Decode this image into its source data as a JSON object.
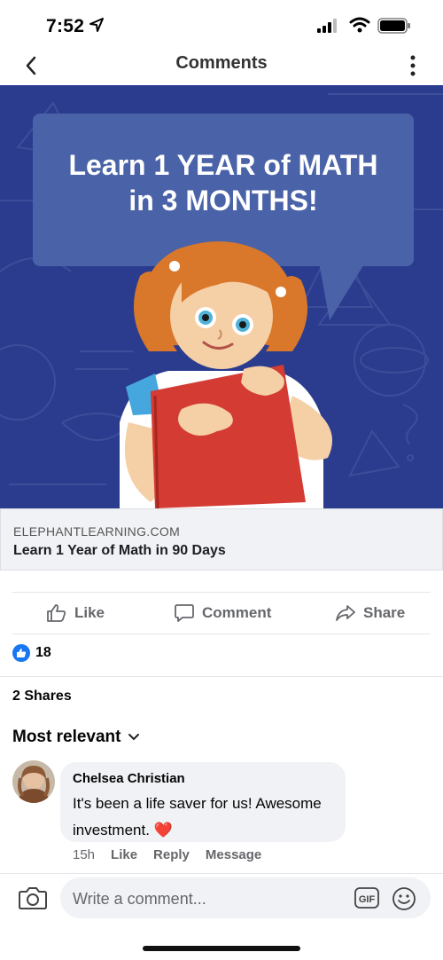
{
  "status_bar": {
    "time": "7:52",
    "icons": [
      "location-arrow-icon",
      "cellular-signal-icon",
      "wifi-icon",
      "battery-icon"
    ]
  },
  "nav": {
    "title": "Comments",
    "back_icon": "chevron-left-icon",
    "more_icon": "more-vertical-icon"
  },
  "ad": {
    "image_headline_line1": "Learn 1 YEAR of MATH",
    "image_headline_line2": "in 3 MONTHS!",
    "domain": "ELEPHANTLEARNING.COM",
    "headline": "Learn 1 Year of Math in 90 Days"
  },
  "actions": {
    "like": "Like",
    "comment": "Comment",
    "share": "Share"
  },
  "reactions": {
    "count": "18",
    "icon": "like-reaction-icon"
  },
  "shares": "2 Shares",
  "sort": {
    "label": "Most relevant"
  },
  "comments": [
    {
      "author": "Chelsea Christian",
      "text": "It's been a life saver for us! Awesome investment. ❤️",
      "time": "15h",
      "like": "Like",
      "reply": "Reply",
      "message": "Message"
    }
  ],
  "composer": {
    "placeholder": "Write a comment...",
    "gif_label": "GIF"
  },
  "colors": {
    "hero_bg": "#2b3d8f",
    "bubble": "#4a63a8",
    "like_blue": "#1877f2",
    "muted_text": "#65676b"
  }
}
